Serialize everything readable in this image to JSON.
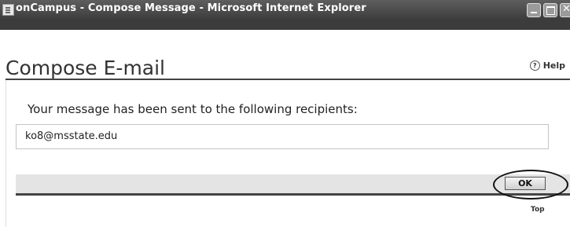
{
  "window": {
    "title": "onCampus - Compose Message - Microsoft Internet Explorer",
    "icon": "ie-page-icon",
    "controls": [
      "minimize-icon",
      "maximize-icon",
      "close-icon"
    ]
  },
  "header": {
    "title": "Compose E-mail",
    "help_label": "Help",
    "help_icon": "?"
  },
  "main": {
    "message": "Your message has been sent to the following recipients:",
    "recipients": "ko8@msstate.edu"
  },
  "actions": {
    "ok_label": "OK",
    "top_link": "Top"
  },
  "colors": {
    "titlebar": "#3a3a3a",
    "button_bar": "#e4e4e4",
    "rule": "#444444"
  }
}
